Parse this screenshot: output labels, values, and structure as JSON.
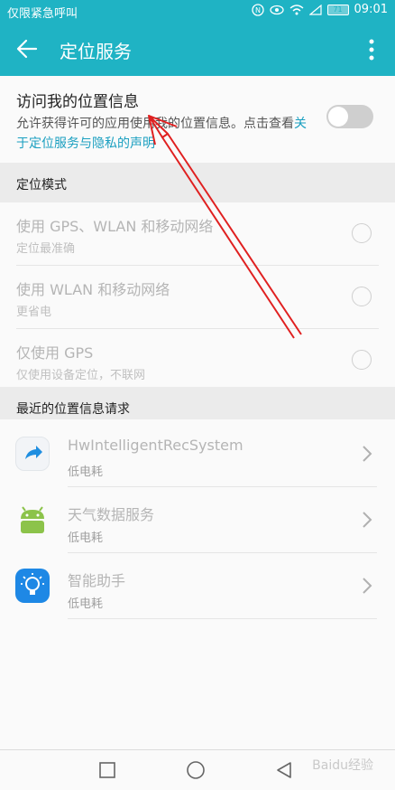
{
  "status_bar": {
    "carrier": "仅限紧急呼叫",
    "battery": "71",
    "time": "09:01"
  },
  "app_bar": {
    "title": "定位服务"
  },
  "access": {
    "title": "访问我的位置信息",
    "desc": "允许获得许可的应用使用我的位置信息。点击查看",
    "link": "关于定位服务与隐私的声明",
    "enabled": false
  },
  "sections": {
    "mode": "定位模式",
    "recent": "最近的位置信息请求"
  },
  "modes": [
    {
      "title": "使用 GPS、WLAN 和移动网络",
      "subtitle": "定位最准确"
    },
    {
      "title": "使用 WLAN 和移动网络",
      "subtitle": "更省电"
    },
    {
      "title": "仅使用 GPS",
      "subtitle": "仅使用设备定位，不联网"
    }
  ],
  "requests": [
    {
      "name": "HwIntelligentRecSystem",
      "usage": "低电耗",
      "icon": "blue-arrow-app-icon"
    },
    {
      "name": "天气数据服务",
      "usage": "低电耗",
      "icon": "android-robot-icon"
    },
    {
      "name": "智能助手",
      "usage": "低电耗",
      "icon": "lightbulb-app-icon"
    }
  ],
  "watermark": "Baidu经验",
  "colors": {
    "accent": "#1fb3c4",
    "link": "#1a9fc0",
    "annotation": "#e02020"
  }
}
